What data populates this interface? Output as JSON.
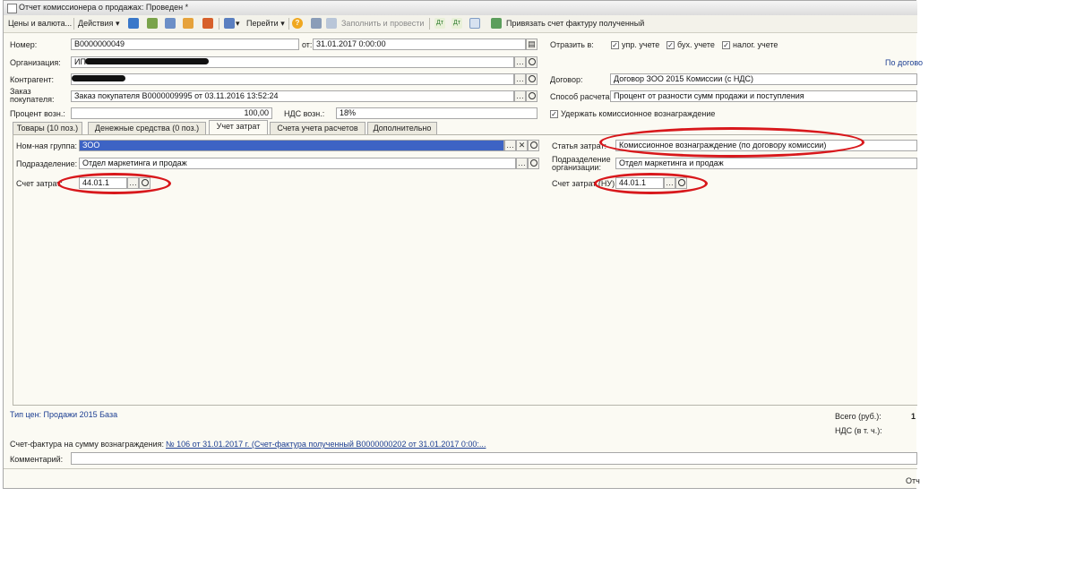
{
  "window": {
    "title": "Отчет комиссионера о продажах: Проведен *"
  },
  "toolbar": {
    "prices_label": "Цены и валюта...",
    "actions_label": "Действия",
    "goto_label": "Перейти",
    "fill_post_label": "Заполнить и провести",
    "attach_invoice_label": "Привязать счет фактуру полученный"
  },
  "header": {
    "number_label": "Номер:",
    "number_value": "В0000000049",
    "date_label": "от:",
    "date_value": "31.01.2017  0:00:00",
    "reflect_label": "Отразить в:",
    "reflect_mgmt_label": "упр. учете",
    "reflect_acc_label": "бух. учете",
    "reflect_tax_label": "налог. учете",
    "org_label": "Организация:",
    "org_value": "ИП",
    "by_contract_link": "По догово",
    "counterparty_label": "Контрагент:",
    "contract_label": "Договор:",
    "contract_value": "Договор ЗОО 2015 Комиссии (с НДС)",
    "customer_order_label": "Заказ покупателя:",
    "customer_order_value": "Заказ покупателя В0000009995 от 03.11.2016 13:52:24",
    "calc_method_label": "Способ расчета:",
    "calc_method_value": "Процент от разности сумм продажи и поступления",
    "fee_percent_label": "Процент возн.:",
    "fee_percent_value": "100,00",
    "vat_fee_label": "НДС возн.:",
    "vat_fee_value": "18%",
    "withhold_label": "Удержать комиссионное вознаграждение"
  },
  "tabs": [
    {
      "label": "Товары (10 поз.)"
    },
    {
      "label": "Денежные средства (0 поз.)"
    },
    {
      "label": "Учет затрат"
    },
    {
      "label": "Счета учета расчетов"
    },
    {
      "label": "Дополнительно"
    }
  ],
  "cost_tab": {
    "nom_group_label": "Ном-ная группа:",
    "nom_group_value": "ЗОО",
    "department_label": "Подразделение:",
    "department_value": "Отдел маркетинга и продаж",
    "cost_account_label": "Счет затрат:",
    "cost_account_value": "44.01.1",
    "cost_item_label": "Статья затрат:",
    "cost_item_value": "Комиссионное вознаграждение (по договору комиссии)",
    "org_department_label": "Подразделение организации:",
    "org_department_value": "Отдел маркетинга и продаж",
    "cost_account_nu_label": "Счет затрат (НУ):",
    "cost_account_nu_value": "44.01.1"
  },
  "footer": {
    "price_type_link": "Тип цен: Продажи 2015 База",
    "total_label": "Всего (руб.):",
    "total_value": "1",
    "vat_label": "НДС (в т. ч.):",
    "invoice_label": "Счет-фактура на сумму вознаграждения:",
    "invoice_link": "№ 106 от 31.01.2017 г. (Счет-фактура полученный В0000000202 от 31.01.2017 0:00:...",
    "comment_label": "Комментарий:",
    "bottom_right": "Отч"
  },
  "icons": [
    "document-icon",
    "dropdown-arrow-icon",
    "post-icon",
    "save-icon",
    "help-icon",
    "list-icon",
    "movements-icon",
    "structure-icon",
    "invoice-link-icon",
    "magnifier-icon",
    "ellipsis-icon",
    "clear-icon"
  ],
  "colors": {
    "selection": "#3d63c4",
    "annotation": "#d8181c",
    "link": "#1d3f93",
    "form_bg": "#fbfaf3"
  }
}
